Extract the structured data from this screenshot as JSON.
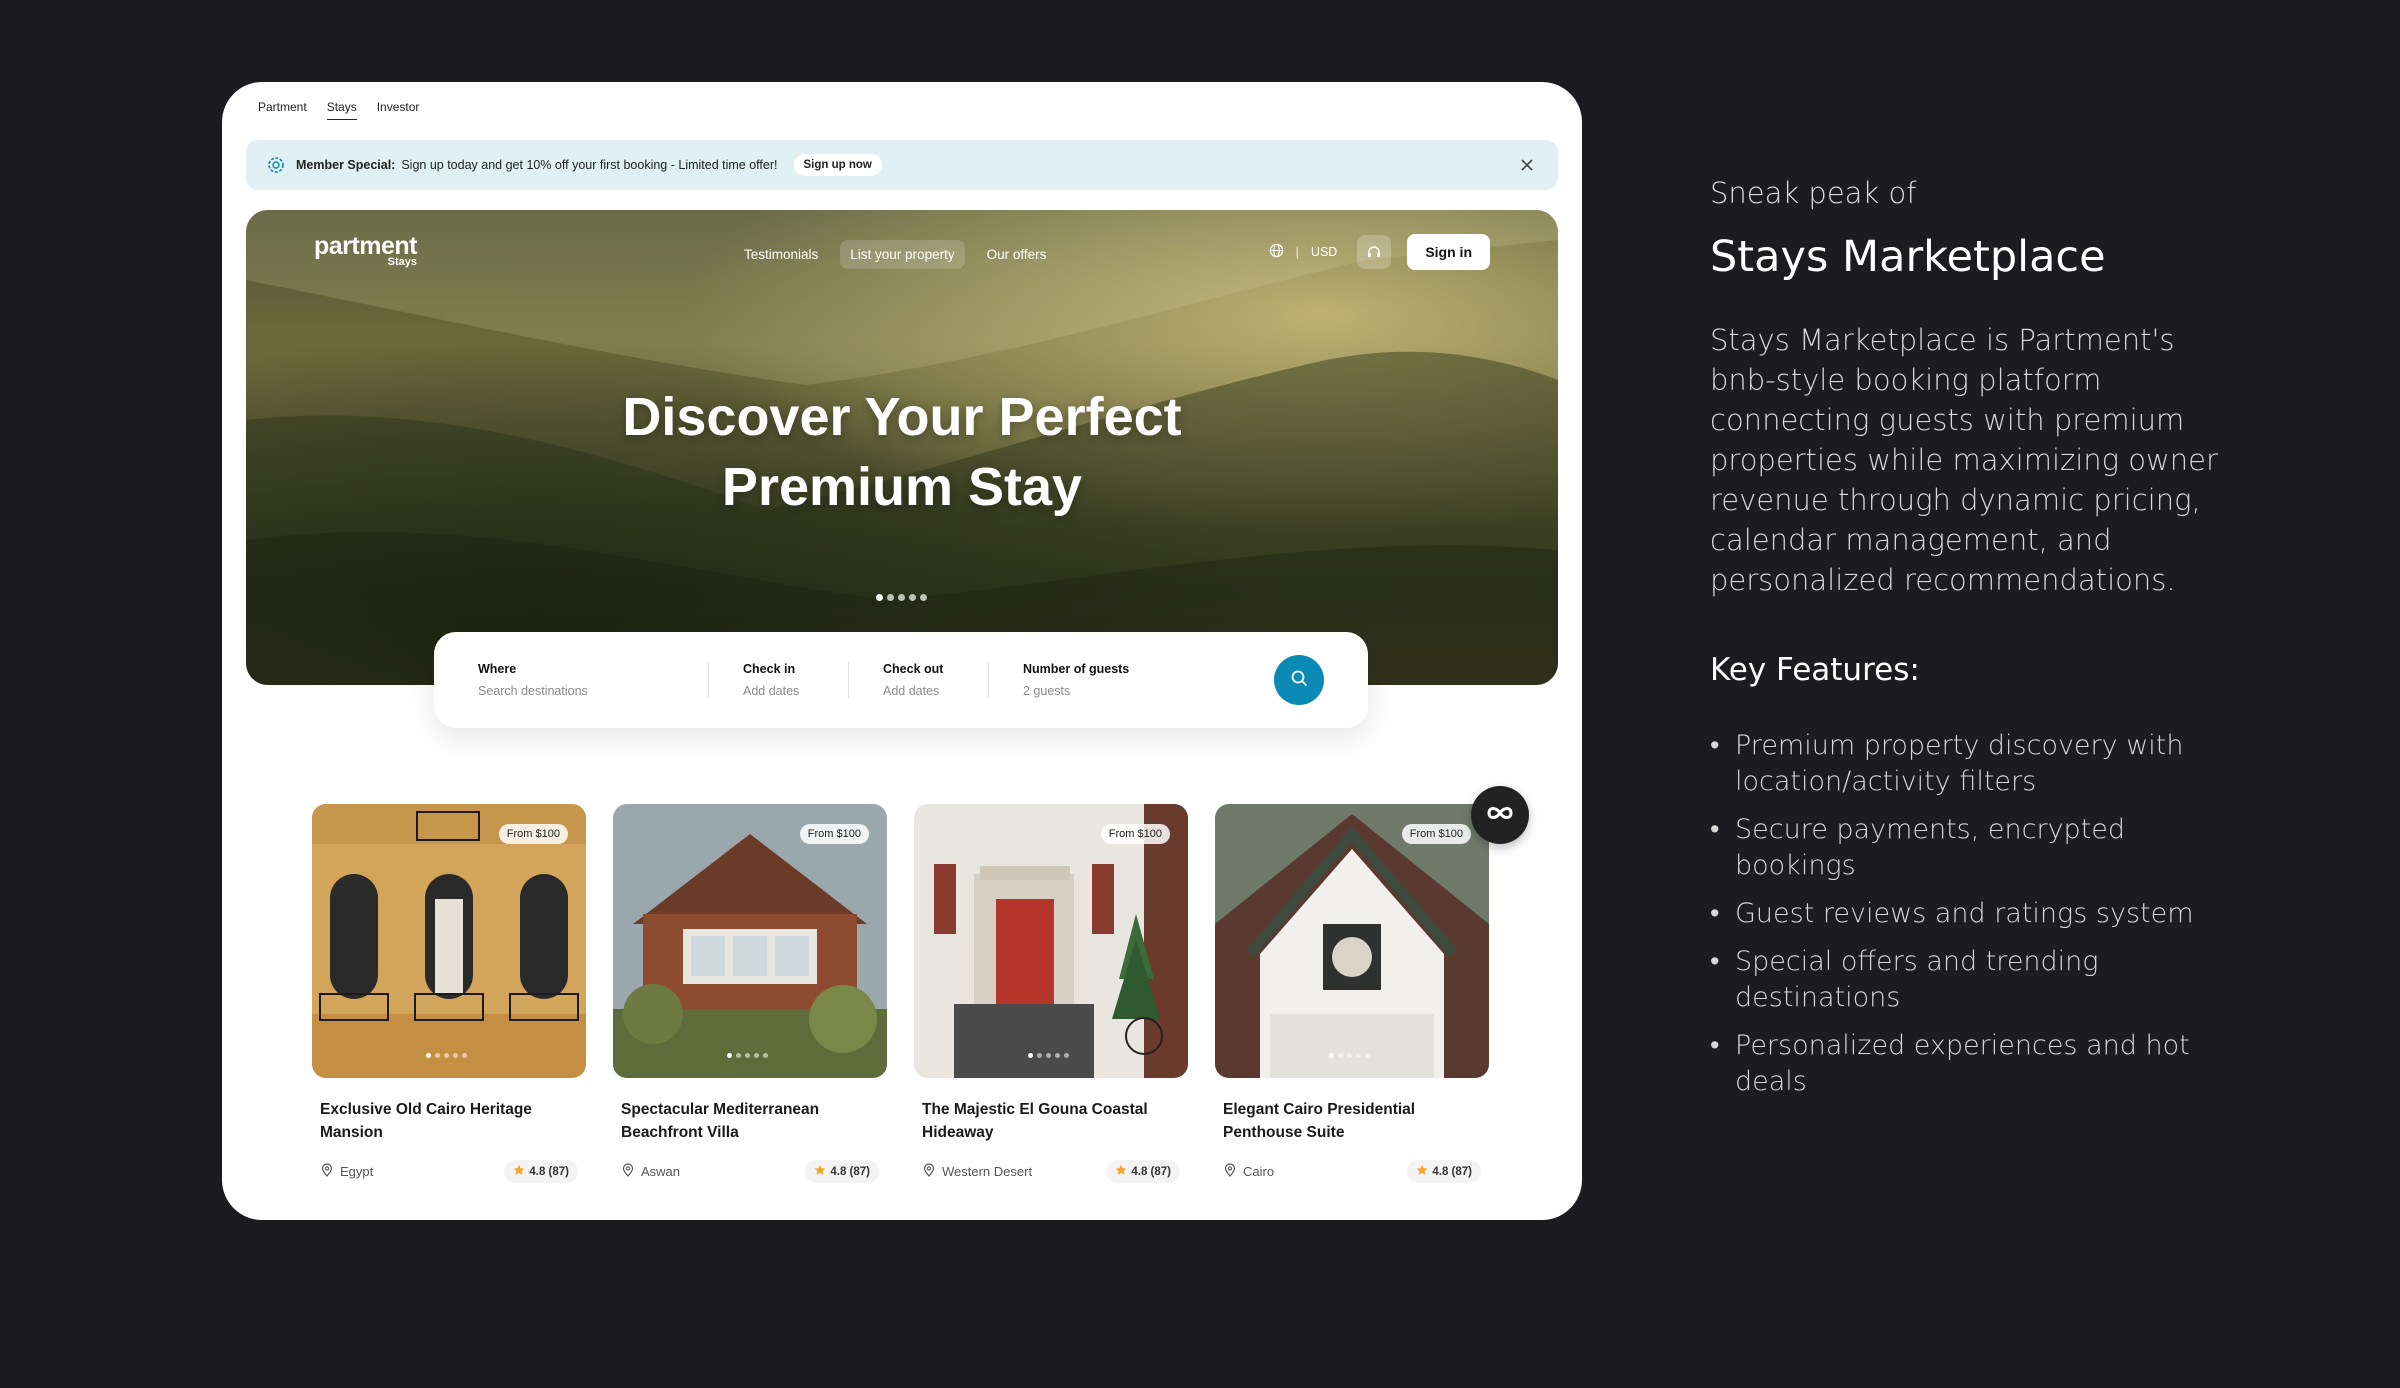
{
  "topnav": {
    "items": [
      "Partment",
      "Stays",
      "Investor"
    ],
    "active": "Stays"
  },
  "promo": {
    "title": "Member Special:",
    "text": "Sign up today and get 10% off your first booking - Limited time offer!",
    "cta": "Sign up now"
  },
  "hero": {
    "logo_main": "partment",
    "logo_sub": "Stays",
    "menu": [
      "Testimonials",
      "List your property",
      "Our offers"
    ],
    "currency": "USD",
    "divider": "|",
    "signin": "Sign in",
    "headline_line1": "Discover Your Perfect",
    "headline_line2": "Premium Stay"
  },
  "search": {
    "where_label": "Where",
    "where_placeholder": "Search destinations",
    "checkin_label": "Check in",
    "checkin_placeholder": "Add dates",
    "checkout_label": "Check out",
    "checkout_placeholder": "Add dates",
    "guests_label": "Number of guests",
    "guests_value": "2 guests"
  },
  "listings": [
    {
      "price": "From $100",
      "title": "Exclusive Old Cairo Heritage Mansion",
      "location": "Egypt",
      "rating": "4.8 (87)"
    },
    {
      "price": "From $100",
      "title": "Spectacular Mediterranean Beachfront Villa",
      "location": "Aswan",
      "rating": "4.8 (87)"
    },
    {
      "price": "From $100",
      "title": "The Majestic El Gouna Coastal Hideaway",
      "location": "Western Desert",
      "rating": "4.8 (87)"
    },
    {
      "price": "From $100",
      "title": "Elegant Cairo Presidential Penthouse Suite",
      "location": "Cairo",
      "rating": "4.8 (87)"
    }
  ],
  "side": {
    "kicker": "Sneak peak of",
    "heading": "Stays Marketplace",
    "description": "Stays Marketplace is Partment's bnb-style booking platform connecting guests with premium properties while maximizing owner revenue through dynamic pricing, calendar management, and personalized recommendations.",
    "features_title": "Key Features:",
    "features": [
      "Premium property discovery with location/activity filters",
      "Secure payments, encrypted bookings",
      "Guest reviews and ratings system",
      "Special offers and trending destinations",
      "Personalized experiences and hot deals"
    ]
  },
  "colors": {
    "background": "#1b1b20",
    "accent": "#0a8ab4",
    "promo_bg": "#e1f0f4",
    "star": "#f5a623"
  },
  "icons": [
    "gear-badge-icon",
    "close-icon",
    "globe-icon",
    "headset-icon",
    "search-icon",
    "location-pin-icon",
    "star-icon",
    "infinity-icon"
  ]
}
